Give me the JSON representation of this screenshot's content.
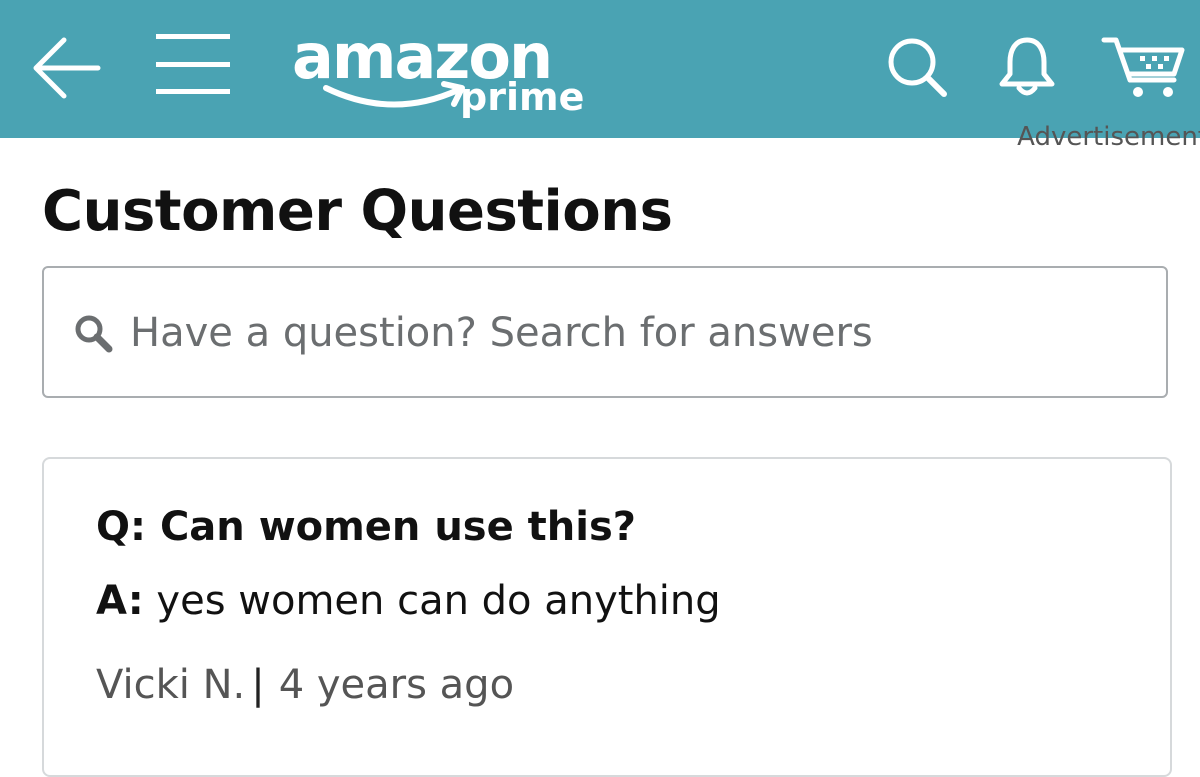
{
  "header": {
    "background_color": "#4aa3b3",
    "icon_color": "#ffffff",
    "back_icon": "back-arrow-icon",
    "menu_icon": "hamburger-menu-icon",
    "logo_word": "amazon",
    "logo_sub": "prime",
    "search_icon": "search-icon",
    "notifications_icon": "bell-icon",
    "cart_icon": "cart-icon"
  },
  "ad_label": "Advertisement",
  "page_title": "Customer Questions",
  "search": {
    "placeholder": "Have a question? Search for answers",
    "value": ""
  },
  "qa": {
    "question_prefix": "Q:",
    "question": "Can women use this?",
    "answer_prefix": "A:",
    "answer": "yes women can do anything",
    "author": "Vicki N.",
    "separator": "|",
    "time_ago": "4 years ago"
  }
}
